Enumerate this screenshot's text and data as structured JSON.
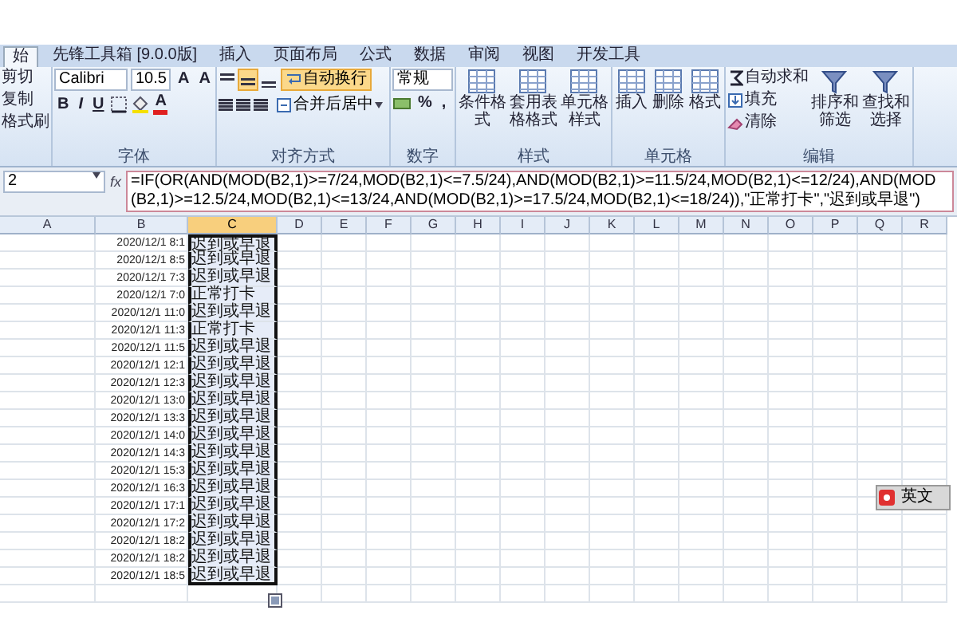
{
  "ribbon_tabs": [
    {
      "label": "始",
      "selected": true
    },
    {
      "label": "先锋工具箱 [9.0.0版]",
      "selected": false
    },
    {
      "label": "插入",
      "selected": false
    },
    {
      "label": "页面布局",
      "selected": false
    },
    {
      "label": "公式",
      "selected": false
    },
    {
      "label": "数据",
      "selected": false
    },
    {
      "label": "审阅",
      "selected": false
    },
    {
      "label": "视图",
      "selected": false
    },
    {
      "label": "开发工具",
      "selected": false
    }
  ],
  "ribbon": {
    "clipboard": {
      "items": [
        "剪切",
        "复制",
        "格式刷"
      ]
    },
    "font": {
      "name": "Calibri",
      "size": "10.5",
      "grow": "A",
      "shrink": "A",
      "bold": "B",
      "italic": "I",
      "underline": "U",
      "color_letter": "A",
      "label": "字体"
    },
    "alignment": {
      "vertical_buttons": [
        {
          "selected": false
        },
        {
          "selected": true
        },
        {
          "selected": false
        }
      ],
      "wrap": {
        "label": "自动换行",
        "on": true
      },
      "merge": "合并后居中",
      "label": "对齐方式"
    },
    "number": {
      "format": "常规",
      "percent": "%",
      "comma": ",",
      "label": "数字"
    },
    "styles": {
      "buttons": [
        "条件格式",
        "套用表格格式",
        "单元格样式"
      ],
      "label": "样式"
    },
    "cells": {
      "buttons": [
        "插入",
        "删除",
        "格式"
      ],
      "label": "单元格"
    },
    "editing": {
      "small": [
        "自动求和",
        "填充",
        "清除"
      ],
      "large": [
        "排序和筛选",
        "查找和选择"
      ],
      "label": "编辑"
    }
  },
  "formula_bar": {
    "name_box": "2",
    "fx": "fx",
    "formula": "=IF(OR(AND(MOD(B2,1)>=7/24,MOD(B2,1)<=7.5/24),AND(MOD(B2,1)>=11.5/24,MOD(B2,1)<=12/24),AND(MOD(B2,1)>=12.5/24,MOD(B2,1)<=13/24,AND(MOD(B2,1)>=17.5/24,MOD(B2,1)<=18/24)),\"正常打卡\",\"迟到或早退\")"
  },
  "columns": [
    {
      "label": "A",
      "selected": false
    },
    {
      "label": "B",
      "selected": false
    },
    {
      "label": "C",
      "selected": true
    },
    {
      "label": "D",
      "selected": false
    },
    {
      "label": "E",
      "selected": false
    },
    {
      "label": "F",
      "selected": false
    },
    {
      "label": "G",
      "selected": false
    },
    {
      "label": "H",
      "selected": false
    },
    {
      "label": "I",
      "selected": false
    },
    {
      "label": "J",
      "selected": false
    },
    {
      "label": "K",
      "selected": false
    },
    {
      "label": "L",
      "selected": false
    },
    {
      "label": "M",
      "selected": false
    },
    {
      "label": "N",
      "selected": false
    },
    {
      "label": "O",
      "selected": false
    },
    {
      "label": "P",
      "selected": false
    },
    {
      "label": "Q",
      "selected": false
    },
    {
      "label": "R",
      "selected": false
    }
  ],
  "rows": [
    {
      "b": "2020/12/1 8:1",
      "c": "迟到或早退"
    },
    {
      "b": "2020/12/1 8:5",
      "c": "迟到或早退"
    },
    {
      "b": "2020/12/1 7:3",
      "c": "迟到或早退"
    },
    {
      "b": "2020/12/1 7:0",
      "c": "正常打卡"
    },
    {
      "b": "2020/12/1 11:0",
      "c": "迟到或早退"
    },
    {
      "b": "2020/12/1 11:3",
      "c": "正常打卡"
    },
    {
      "b": "2020/12/1 11:5",
      "c": "迟到或早退"
    },
    {
      "b": "2020/12/1 12:1",
      "c": "迟到或早退"
    },
    {
      "b": "2020/12/1 12:3",
      "c": "迟到或早退"
    },
    {
      "b": "2020/12/1 13:0",
      "c": "迟到或早退"
    },
    {
      "b": "2020/12/1 13:3",
      "c": "迟到或早退"
    },
    {
      "b": "2020/12/1 14:0",
      "c": "迟到或早退"
    },
    {
      "b": "2020/12/1 14:3",
      "c": "迟到或早退"
    },
    {
      "b": "2020/12/1 15:3",
      "c": "迟到或早退"
    },
    {
      "b": "2020/12/1 16:3",
      "c": "迟到或早退"
    },
    {
      "b": "2020/12/1 17:1",
      "c": "迟到或早退"
    },
    {
      "b": "2020/12/1 17:2",
      "c": "迟到或早退"
    },
    {
      "b": "2020/12/1 18:2",
      "c": "迟到或早退"
    },
    {
      "b": "2020/12/1 18:2",
      "c": "迟到或早退"
    },
    {
      "b": "2020/12/1 18:5",
      "c": "迟到或早退"
    }
  ],
  "ime_bar": {
    "label": "英文"
  }
}
